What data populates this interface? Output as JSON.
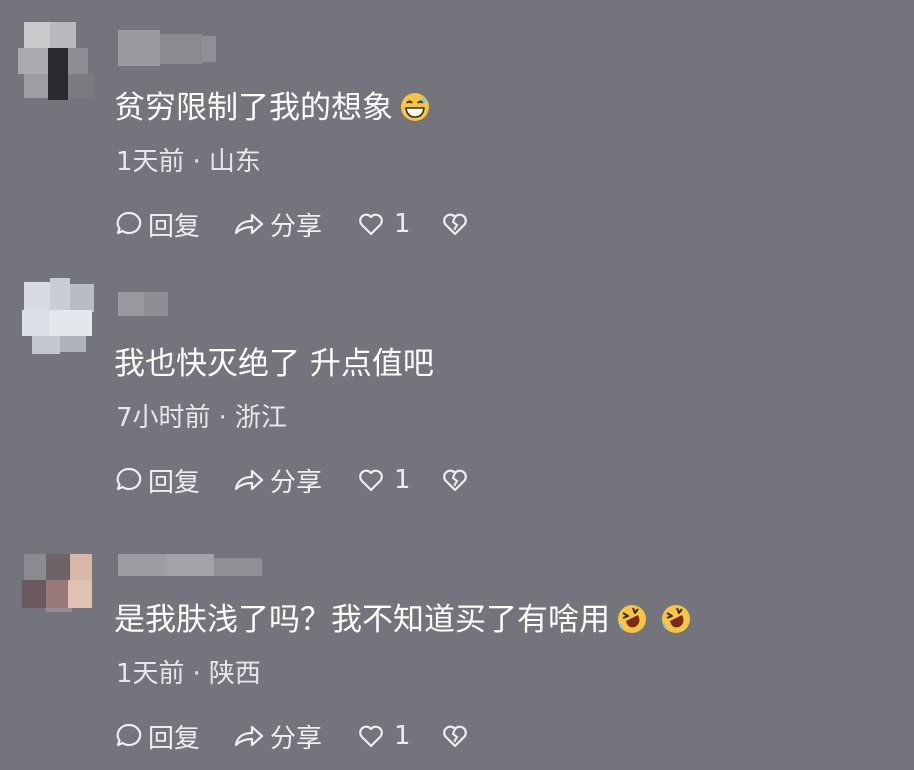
{
  "comments": [
    {
      "text": "贫穷限制了我的想象",
      "emojis": [
        "grinning-sweat-emoji"
      ],
      "time": "1天前",
      "separator": "·",
      "location": "山东",
      "actions": {
        "reply": "回复",
        "share": "分享",
        "like_count": "1"
      }
    },
    {
      "text": "我也快灭绝了 升点值吧",
      "emojis": [],
      "time": "7小时前",
      "separator": "·",
      "location": "浙江",
      "actions": {
        "reply": "回复",
        "share": "分享",
        "like_count": "1"
      }
    },
    {
      "text": "是我肤浅了吗？我不知道买了有啥用",
      "emojis": [
        "rolling-laughing-emoji",
        "rolling-laughing-emoji"
      ],
      "time": "1天前",
      "separator": "·",
      "location": "陕西",
      "actions": {
        "reply": "回复",
        "share": "分享",
        "like_count": "1"
      }
    }
  ],
  "colors": {
    "background": "#74757c",
    "text": "#ffffff",
    "meta_text": "#e6e7ea",
    "emoji_yellow": "#f6c541"
  },
  "icons": [
    "comment-bubble-icon",
    "share-arrow-icon",
    "heart-icon",
    "broken-heart-icon"
  ]
}
